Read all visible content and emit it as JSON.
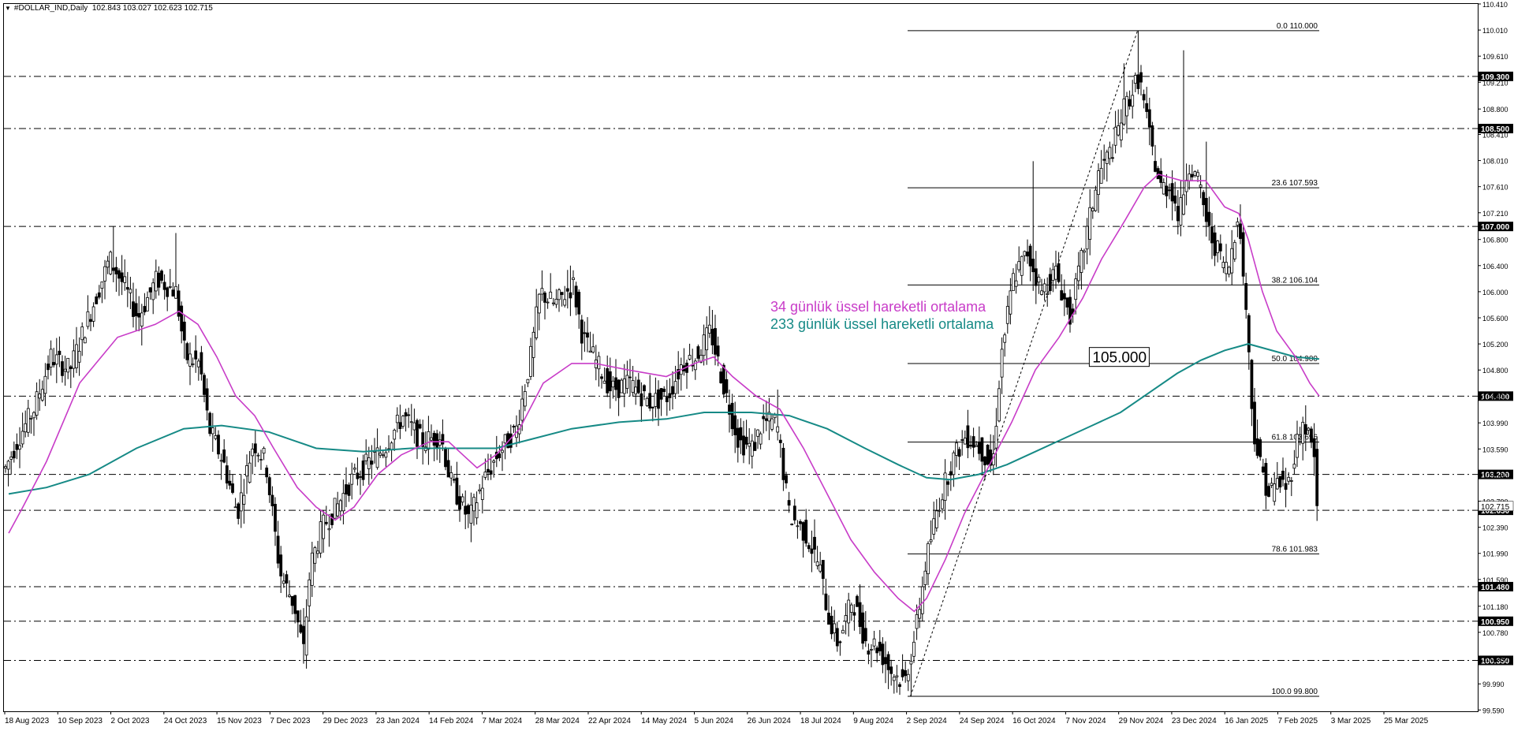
{
  "window": {
    "symbol": "#DOLLAR_IND,Daily",
    "ohlc": "102.843 103.027 102.623 102.715"
  },
  "colors": {
    "background": "#ffffff",
    "candle": "#000000",
    "ema34": "#c83cc8",
    "ema233": "#168a86",
    "level_line": "#000000",
    "label_bg": "#000000",
    "label_text": "#ffffff"
  },
  "legend": {
    "ema34_label": "34 günlük üssel hareketli ortalama",
    "ema233_label": "233 günlük üssel hareketli ortalama"
  },
  "chart_data": {
    "type": "candlestick",
    "y_range": [
      99.57,
      110.41
    ],
    "y_ticks": [
      "110.410",
      "110.010",
      "109.610",
      "109.210",
      "108.800",
      "108.410",
      "108.010",
      "107.610",
      "107.210",
      "106.800",
      "106.400",
      "106.000",
      "105.600",
      "105.200",
      "104.800",
      "104.400",
      "103.990",
      "103.590",
      "103.190",
      "102.790",
      "102.390",
      "101.990",
      "101.590",
      "101.180",
      "100.780",
      "100.380",
      "99.990",
      "99.590"
    ],
    "x_labels": [
      "18 Aug 2023",
      "10 Sep 2023",
      "2 Oct 2023",
      "24 Oct 2023",
      "15 Nov 2023",
      "7 Dec 2023",
      "29 Dec 2023",
      "23 Jan 2024",
      "14 Feb 2024",
      "7 Mar 2024",
      "28 Mar 2024",
      "22 Apr 2024",
      "14 May 2024",
      "5 Jun 2024",
      "26 Jun 2024",
      "18 Jul 2024",
      "9 Aug 2024",
      "2 Sep 2024",
      "24 Sep 2024",
      "16 Oct 2024",
      "7 Nov 2024",
      "29 Nov 2024",
      "23 Dec 2024",
      "16 Jan 2025",
      "7 Feb 2025",
      "3 Mar 2025",
      "25 Mar 2025"
    ],
    "horizontal_levels": [
      {
        "value": 109.3,
        "label": "109.300"
      },
      {
        "value": 108.5,
        "label": "108.500"
      },
      {
        "value": 107.0,
        "label": "107.000"
      },
      {
        "value": 104.4,
        "label": "104.400"
      },
      {
        "value": 103.2,
        "label": "103.200"
      },
      {
        "value": 102.65,
        "label": "102.650"
      },
      {
        "value": 101.48,
        "label": "101.480"
      },
      {
        "value": 100.95,
        "label": "100.950"
      },
      {
        "value": 100.35,
        "label": "100.350"
      }
    ],
    "fibonacci": [
      {
        "value": 110.0,
        "label": "0.0 110.000"
      },
      {
        "value": 107.593,
        "label": "23.6 107.593"
      },
      {
        "value": 106.104,
        "label": "38.2 106.104"
      },
      {
        "value": 104.9,
        "label": "50.0 104.900"
      },
      {
        "value": 103.696,
        "label": "61.8 103.696"
      },
      {
        "value": 101.983,
        "label": "78.6 101.983"
      },
      {
        "value": 99.8,
        "label": "100.0 99.800"
      }
    ],
    "annotation": {
      "value": 105.0,
      "label": "105.000"
    },
    "current_price": {
      "value": 102.715,
      "label": "102.715"
    },
    "trendline": {
      "from": [
        958,
        99.8
      ],
      "to": [
        1198,
        110.0
      ]
    },
    "price_anchors": [
      [
        0,
        103.3
      ],
      [
        15,
        103.8
      ],
      [
        30,
        104.2
      ],
      [
        48,
        105.0
      ],
      [
        68,
        104.8
      ],
      [
        90,
        105.7
      ],
      [
        110,
        106.5
      ],
      [
        125,
        106.1
      ],
      [
        140,
        105.6
      ],
      [
        160,
        106.2
      ],
      [
        180,
        106.0
      ],
      [
        190,
        105.0
      ],
      [
        205,
        104.9
      ],
      [
        215,
        103.9
      ],
      [
        230,
        103.4
      ],
      [
        245,
        102.6
      ],
      [
        262,
        103.7
      ],
      [
        275,
        103.4
      ],
      [
        290,
        101.7
      ],
      [
        305,
        101.2
      ],
      [
        315,
        100.5
      ],
      [
        322,
        101.8
      ],
      [
        335,
        102.4
      ],
      [
        350,
        102.7
      ],
      [
        365,
        103.1
      ],
      [
        385,
        103.4
      ],
      [
        400,
        103.6
      ],
      [
        420,
        104.1
      ],
      [
        440,
        103.7
      ],
      [
        460,
        103.8
      ],
      [
        470,
        103.1
      ],
      [
        490,
        102.5
      ],
      [
        505,
        103.1
      ],
      [
        520,
        103.5
      ],
      [
        540,
        103.9
      ],
      [
        555,
        105.0
      ],
      [
        565,
        106.0
      ],
      [
        580,
        105.8
      ],
      [
        600,
        106.1
      ],
      [
        610,
        105.3
      ],
      [
        625,
        104.9
      ],
      [
        640,
        104.5
      ],
      [
        660,
        104.6
      ],
      [
        680,
        104.3
      ],
      [
        700,
        104.4
      ],
      [
        715,
        104.9
      ],
      [
        730,
        105.0
      ],
      [
        745,
        105.4
      ],
      [
        760,
        104.5
      ],
      [
        775,
        103.7
      ],
      [
        790,
        103.6
      ],
      [
        800,
        104.0
      ],
      [
        815,
        104.0
      ],
      [
        828,
        102.6
      ],
      [
        845,
        102.3
      ],
      [
        860,
        101.8
      ],
      [
        870,
        101.0
      ],
      [
        880,
        100.6
      ],
      [
        895,
        101.3
      ],
      [
        910,
        100.6
      ],
      [
        920,
        100.6
      ],
      [
        935,
        100.2
      ],
      [
        950,
        100.0
      ],
      [
        962,
        100.8
      ],
      [
        972,
        101.8
      ],
      [
        985,
        102.7
      ],
      [
        1000,
        103.4
      ],
      [
        1015,
        103.8
      ],
      [
        1030,
        103.6
      ],
      [
        1043,
        103.3
      ],
      [
        1052,
        105.0
      ],
      [
        1065,
        106.2
      ],
      [
        1080,
        106.6
      ],
      [
        1095,
        106.0
      ],
      [
        1110,
        106.3
      ],
      [
        1125,
        105.6
      ],
      [
        1140,
        106.7
      ],
      [
        1155,
        107.8
      ],
      [
        1170,
        108.2
      ],
      [
        1182,
        108.8
      ],
      [
        1198,
        109.3
      ],
      [
        1210,
        108.3
      ],
      [
        1220,
        107.6
      ],
      [
        1232,
        107.6
      ],
      [
        1240,
        107.1
      ],
      [
        1250,
        108.0
      ],
      [
        1262,
        107.6
      ],
      [
        1272,
        106.9
      ],
      [
        1282,
        106.6
      ],
      [
        1292,
        106.3
      ],
      [
        1302,
        107.2
      ],
      [
        1310,
        106.0
      ],
      [
        1318,
        104.0
      ],
      [
        1325,
        103.4
      ],
      [
        1335,
        102.9
      ],
      [
        1345,
        103.1
      ],
      [
        1355,
        103.0
      ],
      [
        1365,
        103.7
      ],
      [
        1372,
        104.0
      ],
      [
        1382,
        103.6
      ],
      [
        1388,
        102.72
      ]
    ],
    "price_spikes": [
      {
        "x": 115,
        "high": 107.0
      },
      {
        "x": 181,
        "high": 106.9
      },
      {
        "x": 598,
        "high": 106.4
      },
      {
        "x": 815,
        "high": 104.5
      },
      {
        "x": 858,
        "low": 101.9
      },
      {
        "x": 1087,
        "high": 108.0
      },
      {
        "x": 1182,
        "high": 109.5
      },
      {
        "x": 1198,
        "high": 110.0
      },
      {
        "x": 1246,
        "high": 109.7
      },
      {
        "x": 1268,
        "high": 108.3
      },
      {
        "x": 316,
        "low": 100.3
      },
      {
        "x": 958,
        "low": 99.8
      }
    ],
    "ema34_points": [
      [
        5,
        102.3
      ],
      [
        20,
        102.7
      ],
      [
        45,
        103.4
      ],
      [
        80,
        104.6
      ],
      [
        120,
        105.3
      ],
      [
        160,
        105.5
      ],
      [
        185,
        105.7
      ],
      [
        205,
        105.5
      ],
      [
        225,
        105.0
      ],
      [
        245,
        104.4
      ],
      [
        265,
        104.1
      ],
      [
        285,
        103.6
      ],
      [
        310,
        103.0
      ],
      [
        330,
        102.7
      ],
      [
        350,
        102.5
      ],
      [
        370,
        102.7
      ],
      [
        395,
        103.2
      ],
      [
        420,
        103.5
      ],
      [
        450,
        103.7
      ],
      [
        470,
        103.7
      ],
      [
        485,
        103.5
      ],
      [
        500,
        103.3
      ],
      [
        520,
        103.5
      ],
      [
        545,
        103.9
      ],
      [
        570,
        104.6
      ],
      [
        600,
        104.9
      ],
      [
        625,
        104.9
      ],
      [
        660,
        104.8
      ],
      [
        700,
        104.7
      ],
      [
        730,
        104.9
      ],
      [
        750,
        105.0
      ],
      [
        770,
        104.7
      ],
      [
        795,
        104.4
      ],
      [
        820,
        104.2
      ],
      [
        845,
        103.6
      ],
      [
        870,
        102.9
      ],
      [
        895,
        102.2
      ],
      [
        920,
        101.7
      ],
      [
        945,
        101.3
      ],
      [
        962,
        101.1
      ],
      [
        975,
        101.3
      ],
      [
        995,
        101.9
      ],
      [
        1015,
        102.6
      ],
      [
        1040,
        103.3
      ],
      [
        1065,
        104.0
      ],
      [
        1090,
        104.8
      ],
      [
        1115,
        105.3
      ],
      [
        1140,
        105.9
      ],
      [
        1160,
        106.5
      ],
      [
        1185,
        107.1
      ],
      [
        1205,
        107.6
      ],
      [
        1220,
        107.8
      ],
      [
        1245,
        107.7
      ],
      [
        1270,
        107.7
      ],
      [
        1290,
        107.3
      ],
      [
        1305,
        107.2
      ],
      [
        1315,
        106.8
      ],
      [
        1330,
        106.0
      ],
      [
        1345,
        105.4
      ],
      [
        1365,
        105.0
      ],
      [
        1380,
        104.6
      ],
      [
        1390,
        104.4
      ]
    ],
    "ema233_points": [
      [
        5,
        102.9
      ],
      [
        45,
        103.0
      ],
      [
        90,
        103.2
      ],
      [
        140,
        103.6
      ],
      [
        190,
        103.9
      ],
      [
        230,
        103.95
      ],
      [
        280,
        103.85
      ],
      [
        330,
        103.6
      ],
      [
        380,
        103.55
      ],
      [
        430,
        103.6
      ],
      [
        480,
        103.6
      ],
      [
        520,
        103.6
      ],
      [
        560,
        103.75
      ],
      [
        600,
        103.9
      ],
      [
        650,
        104.0
      ],
      [
        700,
        104.05
      ],
      [
        740,
        104.15
      ],
      [
        790,
        104.15
      ],
      [
        830,
        104.1
      ],
      [
        870,
        103.9
      ],
      [
        910,
        103.6
      ],
      [
        945,
        103.35
      ],
      [
        975,
        103.15
      ],
      [
        1000,
        103.12
      ],
      [
        1030,
        103.2
      ],
      [
        1060,
        103.35
      ],
      [
        1090,
        103.55
      ],
      [
        1120,
        103.75
      ],
      [
        1150,
        103.95
      ],
      [
        1180,
        104.15
      ],
      [
        1210,
        104.45
      ],
      [
        1240,
        104.75
      ],
      [
        1265,
        104.95
      ],
      [
        1290,
        105.1
      ],
      [
        1315,
        105.2
      ],
      [
        1340,
        105.1
      ],
      [
        1365,
        105.0
      ],
      [
        1390,
        104.97
      ]
    ]
  }
}
